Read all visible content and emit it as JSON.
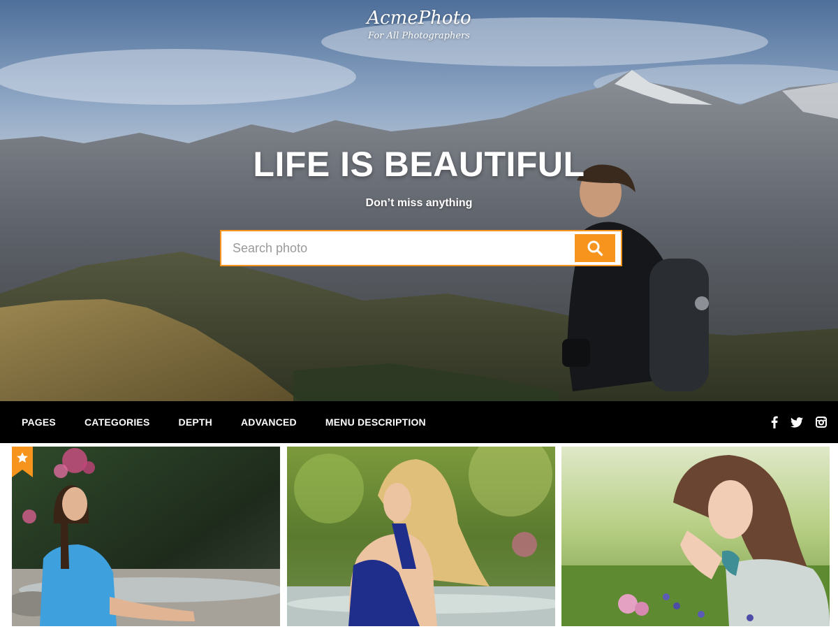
{
  "site": {
    "name": "AcmePhoto",
    "tagline": "For All Photographers"
  },
  "hero": {
    "title": "LIFE IS BEAUTIFUL",
    "subtitle": "Don’t miss anything",
    "search": {
      "placeholder": "Search photo",
      "value": "",
      "button_icon": "search-icon"
    }
  },
  "nav": {
    "items": [
      {
        "label": "PAGES"
      },
      {
        "label": "CATEGORIES"
      },
      {
        "label": "DEPTH"
      },
      {
        "label": "ADVANCED"
      },
      {
        "label": "MENU DESCRIPTION"
      }
    ],
    "social": [
      {
        "icon": "facebook-icon"
      },
      {
        "icon": "twitter-icon"
      },
      {
        "icon": "instagram-icon"
      }
    ]
  },
  "gallery": {
    "items": [
      {
        "image": "woman-in-blue-shirt-sitting-by-river",
        "featured": true,
        "badge_icon": "star-icon"
      },
      {
        "image": "blonde-woman-in-blue-dress-by-stream",
        "featured": false
      },
      {
        "image": "woman-lying-in-flower-meadow",
        "featured": false
      }
    ]
  },
  "colors": {
    "accent": "#f7941d",
    "nav_background": "#000000",
    "text_on_dark": "#ffffff"
  }
}
